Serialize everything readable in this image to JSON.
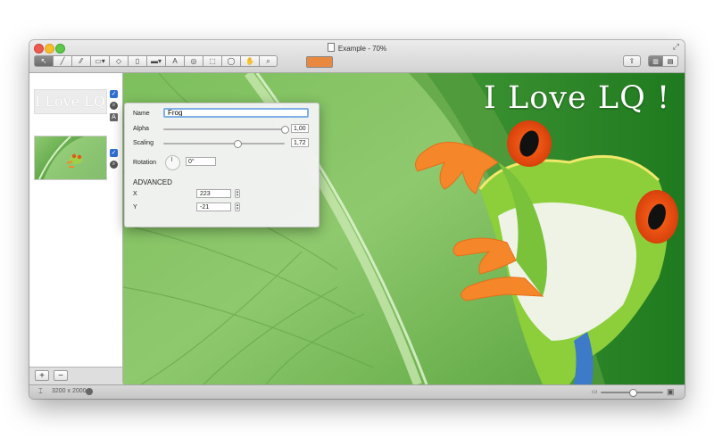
{
  "window": {
    "title": "Example - 70%"
  },
  "toolbar": {
    "tools": [
      {
        "name": "select",
        "glyph": "↖"
      },
      {
        "name": "line",
        "glyph": "╱"
      },
      {
        "name": "pen",
        "glyph": "⁄⁄"
      },
      {
        "name": "rectangle",
        "glyph": "▭▾"
      },
      {
        "name": "eraser",
        "glyph": "◇"
      },
      {
        "name": "bucket",
        "glyph": "▯"
      },
      {
        "name": "gradient",
        "glyph": "▬▾"
      },
      {
        "name": "text",
        "glyph": "A"
      },
      {
        "name": "target",
        "glyph": "◎"
      },
      {
        "name": "marquee",
        "glyph": "⬚"
      },
      {
        "name": "lasso",
        "glyph": "◯"
      },
      {
        "name": "hand",
        "glyph": "✋"
      },
      {
        "name": "zoom",
        "glyph": "⌕"
      }
    ],
    "color": "#e8893f"
  },
  "sidebar": {
    "text_layer_preview": "I Love LQ !",
    "badge_text": "A",
    "check": "✓",
    "mag": "⌕",
    "add": "+",
    "remove": "−"
  },
  "canvas": {
    "overlay_text": "I Love LQ !"
  },
  "panel": {
    "name_label": "Name",
    "name_value": "Frog",
    "alpha_label": "Alpha",
    "alpha_value": "1,00",
    "alpha_fraction": 1.0,
    "scaling_label": "Scaling",
    "scaling_value": "1,72",
    "scaling_fraction": 0.61,
    "rotation_label": "Rotation",
    "rotation_value": "0°",
    "advanced_label": "ADVANCED",
    "x_label": "X",
    "x_value": "223",
    "y_label": "Y",
    "y_value": "-21"
  },
  "status": {
    "dimensions": "3200 x 2000",
    "zoom_fraction": 0.45
  }
}
